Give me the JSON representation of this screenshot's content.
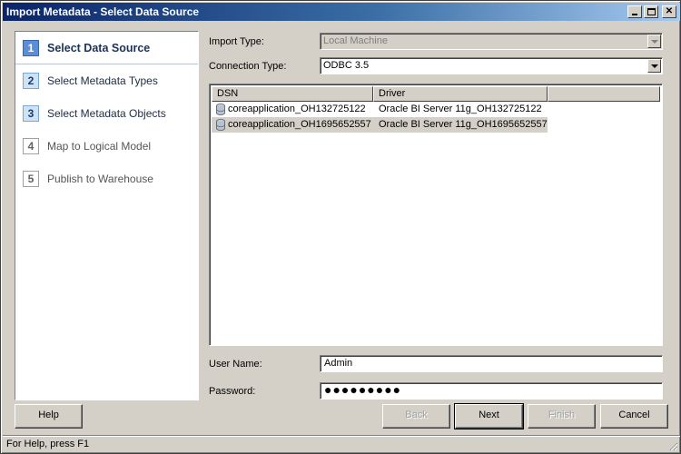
{
  "window": {
    "title": "Import Metadata - Select Data Source"
  },
  "steps": [
    {
      "num": "1",
      "label": "Select Data Source",
      "state": "active"
    },
    {
      "num": "2",
      "label": "Select Metadata Types",
      "state": "enabled"
    },
    {
      "num": "3",
      "label": "Select Metadata Objects",
      "state": "enabled"
    },
    {
      "num": "4",
      "label": "Map to Logical Model",
      "state": "disabled"
    },
    {
      "num": "5",
      "label": "Publish to Warehouse",
      "state": "disabled"
    }
  ],
  "form": {
    "import_type_label": "Import Type:",
    "import_type_value": "Local Machine",
    "connection_type_label": "Connection Type:",
    "connection_type_value": "ODBC 3.5",
    "user_name_label": "User Name:",
    "user_name_value": "Admin",
    "password_label": "Password:",
    "password_value": "●●●●●●●●●"
  },
  "dsn_list": {
    "columns": [
      "DSN",
      "Driver"
    ],
    "rows": [
      {
        "dsn": "coreapplication_OH132725122",
        "driver": "Oracle BI Server 11g_OH132725122",
        "selected": false
      },
      {
        "dsn": "coreapplication_OH1695652557",
        "driver": "Oracle BI Server 11g_OH1695652557",
        "selected": true
      }
    ]
  },
  "buttons": {
    "help": "Help",
    "back": "Back",
    "next": "Next",
    "finish": "Finish",
    "cancel": "Cancel"
  },
  "status": {
    "text": "For Help, press F1"
  },
  "icons": {
    "database": "database-icon",
    "minimize": "minimize-icon",
    "maximize": "maximize-icon",
    "close": "close-icon"
  }
}
